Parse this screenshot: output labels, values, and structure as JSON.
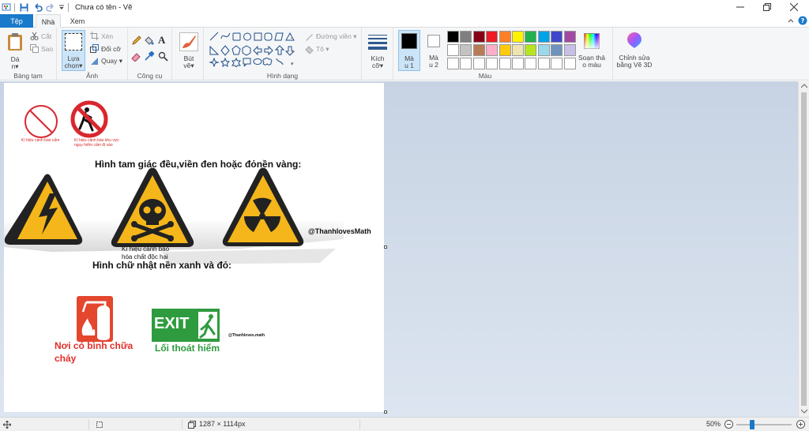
{
  "window": {
    "title": "Chưa có tên - Vẽ"
  },
  "tabs": {
    "file": "Tệp",
    "home": "Nhà",
    "view": "Xem"
  },
  "clipboard": {
    "paste_line1": "Dá",
    "paste_line2": "n",
    "cut": "Cắt",
    "copy": "Sao",
    "label": "Bảng tạm"
  },
  "image": {
    "select_line1": "Lựa",
    "select_line2": "chọn",
    "crop": "Xén",
    "resize": "Đổi cỡ",
    "rotate": "Quay",
    "label": "Ảnh"
  },
  "tools": {
    "label": "Công cụ",
    "text_tool": "A"
  },
  "brushes": {
    "line1": "Bút",
    "line2": "vẽ"
  },
  "shapes": {
    "outline": "Đường viền",
    "fill": "Tô",
    "label": "Hình dạng"
  },
  "size": {
    "line1": "Kích",
    "line2": "cỡ"
  },
  "colors": {
    "color1_line1": "Mà",
    "color1_line2": "u 1",
    "color2_line1": "Mà",
    "color2_line2": "u 2",
    "edit_line1": "Soạn thả",
    "edit_line2": "o màu",
    "paint3d_line1": "Chỉnh sửa",
    "paint3d_line2": "bằng Vẽ 3D",
    "label": "Màu",
    "color1": "#000000",
    "color2": "#ffffff",
    "row1": [
      "#000000",
      "#7f7f7f",
      "#880015",
      "#ed1c24",
      "#ff7f27",
      "#fff200",
      "#22b14c",
      "#00a2e8",
      "#3f48cc",
      "#a349a4"
    ],
    "row2": [
      "#ffffff",
      "#c3c3c3",
      "#b97a57",
      "#ffaec9",
      "#ffc90e",
      "#efe4b0",
      "#b5e61d",
      "#99d9ea",
      "#7092be",
      "#c8bfe7"
    ],
    "row3": [
      "#ffffff",
      "#ffffff",
      "#ffffff",
      "#ffffff",
      "#ffffff",
      "#ffffff",
      "#ffffff",
      "#ffffff",
      "#ffffff",
      "#ffffff"
    ]
  },
  "canvas": {
    "caption_prohibit": "Kí hiệu cảnh báo cấm",
    "caption_danger_zone": "Kí hiệu cảnh báo khu vực nguy hiểm cấm đi vào",
    "heading_triangle": "Hình tam giác đều,viền đen hoặc đỏnền vàng:",
    "watermark1": "@ThanhlovesMath",
    "caption_toxic_line1": "Kí hiệu cảnh báo",
    "caption_toxic_line2": "hóa chất độc hại",
    "heading_rect": "Hình chữ nhật nền xanh và đỏ:",
    "exit_text": "EXIT",
    "caption_extinguisher_line1": "Nơi có bình chữa",
    "caption_extinguisher_line2": "cháy",
    "caption_exit": "Lối thoát hiểm",
    "watermark2": "@Thanhloves.math"
  },
  "status": {
    "dimensions": "1287 × 1114px",
    "zoom": "50%"
  }
}
